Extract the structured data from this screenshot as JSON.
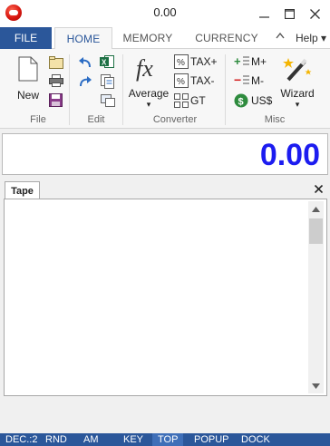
{
  "window": {
    "title": "0.00",
    "minimize_symbol": "—",
    "maximize_symbol": "☐",
    "close_symbol": "✕"
  },
  "tabs": {
    "file": "FILE",
    "items": [
      "HOME",
      "MEMORY",
      "CURRENCY"
    ],
    "active": "HOME",
    "collapse_symbol": "^",
    "help": "Help ▾"
  },
  "ribbon": {
    "file_group": {
      "label": "File",
      "new": "New"
    },
    "edit_group": {
      "label": "Edit"
    },
    "converter_group": {
      "label": "Converter",
      "average": "Average",
      "average_dropdown": "▾",
      "tax_plus": "TAX+",
      "tax_minus": "TAX-",
      "gt": "GT"
    },
    "misc_group": {
      "label": "Misc",
      "m_plus": "M+",
      "m_minus": "M-",
      "us_dollar": "US$",
      "wizard": "Wizard",
      "wizard_dropdown": "▾"
    }
  },
  "display": {
    "value": "0.00",
    "value_color": "#1c1cf0"
  },
  "tape": {
    "tab_label": "Tape",
    "close_symbol": "✕",
    "entries": []
  },
  "status_bar": {
    "items": [
      "DEC.:2",
      "RND",
      "AM",
      "KEY",
      "TOP",
      "POPUP",
      "DOCK"
    ],
    "active": "TOP"
  },
  "colors": {
    "accent": "#2b579a",
    "display_text": "#1c1cf0",
    "status_bg": "#2b579a"
  }
}
